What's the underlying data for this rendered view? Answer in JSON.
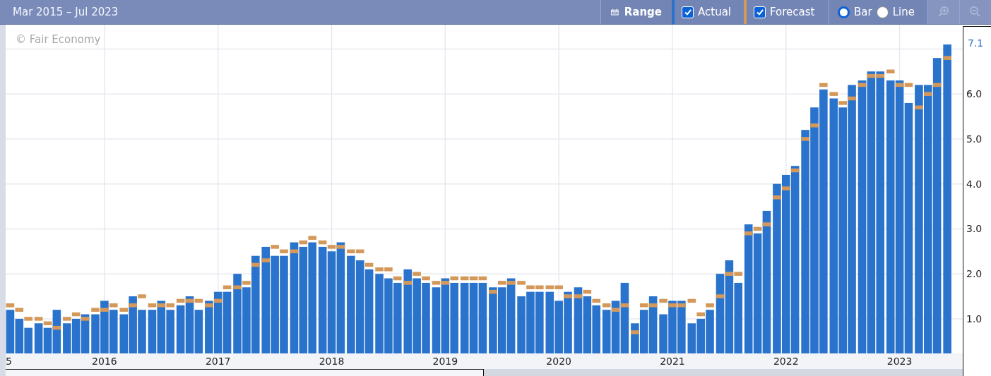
{
  "toolbar": {
    "title": "Mar 2015 – Jul 2023",
    "range_button": "Range",
    "series_toggles": [
      {
        "checked": true
      },
      {
        "checked": true
      }
    ],
    "chart_types": [
      {
        "label": "Bar",
        "selected": true
      },
      {
        "label": "Line",
        "selected": false
      }
    ],
    "zoom_buttons": [
      {
        "kind": "zoom-in",
        "disabled": true
      },
      {
        "kind": "zoom-out",
        "disabled": true
      }
    ]
  },
  "chart": {
    "credit": "© Fair Economy",
    "cut_axis_label": "5",
    "chart_data": {
      "type": "bar",
      "grid": true,
      "ylim": [
        0.23,
        7.54
      ],
      "xlim": [
        2015.13,
        2023.556
      ],
      "yticks": [
        {
          "value": 1,
          "label": "1.0"
        },
        {
          "value": 2,
          "label": "2.0"
        },
        {
          "value": 3,
          "label": "3.0"
        },
        {
          "value": 4,
          "label": "4.0"
        },
        {
          "value": 5,
          "label": "5.0"
        },
        {
          "value": 6,
          "label": "6.0"
        }
      ],
      "xticks": [
        {
          "value": 2016,
          "label": "2016"
        },
        {
          "value": 2017,
          "label": "2017"
        },
        {
          "value": 2018,
          "label": "2018"
        },
        {
          "value": 2019,
          "label": "2019"
        },
        {
          "value": 2020,
          "label": "2020"
        },
        {
          "value": 2021,
          "label": "2021"
        },
        {
          "value": 2022,
          "label": "2022"
        },
        {
          "value": 2023,
          "label": "2023"
        }
      ],
      "x": [
        2015.17,
        2015.25,
        2015.33,
        2015.42,
        2015.5,
        2015.58,
        2015.67,
        2015.75,
        2015.83,
        2015.92,
        2016.0,
        2016.08,
        2016.17,
        2016.25,
        2016.33,
        2016.42,
        2016.5,
        2016.58,
        2016.67,
        2016.75,
        2016.83,
        2016.92,
        2017.0,
        2017.08,
        2017.17,
        2017.25,
        2017.33,
        2017.42,
        2017.5,
        2017.58,
        2017.67,
        2017.75,
        2017.83,
        2017.92,
        2018.0,
        2018.08,
        2018.17,
        2018.25,
        2018.33,
        2018.42,
        2018.5,
        2018.58,
        2018.67,
        2018.75,
        2018.83,
        2018.92,
        2019.0,
        2019.08,
        2019.17,
        2019.25,
        2019.33,
        2019.42,
        2019.5,
        2019.58,
        2019.67,
        2019.75,
        2019.83,
        2019.92,
        2020.0,
        2020.08,
        2020.17,
        2020.25,
        2020.33,
        2020.42,
        2020.5,
        2020.58,
        2020.67,
        2020.75,
        2020.83,
        2020.92,
        2021.0,
        2021.08,
        2021.17,
        2021.25,
        2021.33,
        2021.42,
        2021.5,
        2021.58,
        2021.67,
        2021.75,
        2021.83,
        2021.92,
        2022.0,
        2022.08,
        2022.17,
        2022.25,
        2022.33,
        2022.42,
        2022.5,
        2022.58,
        2022.67,
        2022.75,
        2022.83,
        2022.92,
        2023.0,
        2023.08,
        2023.17,
        2023.25,
        2023.33,
        2023.42
      ],
      "series": [
        {
          "name": "Actual",
          "type": "bar",
          "color": "#2a73cc",
          "values": [
            1.2,
            1.0,
            0.8,
            0.9,
            0.8,
            1.2,
            0.9,
            1.0,
            1.1,
            1.1,
            1.4,
            1.2,
            1.1,
            1.5,
            1.2,
            1.2,
            1.4,
            1.2,
            1.3,
            1.5,
            1.2,
            1.4,
            1.6,
            1.6,
            2.0,
            1.7,
            2.4,
            2.6,
            2.4,
            2.4,
            2.7,
            2.6,
            2.7,
            2.6,
            2.5,
            2.7,
            2.4,
            2.3,
            2.1,
            2.0,
            1.9,
            1.8,
            2.1,
            1.9,
            1.8,
            1.7,
            1.9,
            1.8,
            1.8,
            1.8,
            1.8,
            1.7,
            1.7,
            1.9,
            1.5,
            1.6,
            1.6,
            1.6,
            1.4,
            1.6,
            1.7,
            1.5,
            1.3,
            1.2,
            1.4,
            1.8,
            0.9,
            1.2,
            1.5,
            1.1,
            1.4,
            1.4,
            0.9,
            1.0,
            1.2,
            2.0,
            2.3,
            1.8,
            3.1,
            2.9,
            3.4,
            4.0,
            4.2,
            4.4,
            5.2,
            5.7,
            6.1,
            5.9,
            5.7,
            6.2,
            6.3,
            6.5,
            6.5,
            6.3,
            6.3,
            5.8,
            6.2,
            6.2,
            6.8,
            7.1
          ]
        },
        {
          "name": "Forecast",
          "type": "scatter",
          "color": "#d4995a",
          "values": [
            1.3,
            1.2,
            1.0,
            1.0,
            0.9,
            0.8,
            1.0,
            1.1,
            1.0,
            1.2,
            1.2,
            1.3,
            1.2,
            1.3,
            1.5,
            1.3,
            1.3,
            1.3,
            1.4,
            1.4,
            1.4,
            1.3,
            1.4,
            1.7,
            1.7,
            1.8,
            2.2,
            2.3,
            2.6,
            2.5,
            2.5,
            2.7,
            2.8,
            2.7,
            2.6,
            2.6,
            2.5,
            2.5,
            2.2,
            2.1,
            2.1,
            1.9,
            1.8,
            2.0,
            1.9,
            1.8,
            1.8,
            1.9,
            1.9,
            1.9,
            1.9,
            1.6,
            1.8,
            1.8,
            1.8,
            1.7,
            1.7,
            1.7,
            1.7,
            1.5,
            1.5,
            1.6,
            1.4,
            1.3,
            1.2,
            1.3,
            0.7,
            1.3,
            1.3,
            1.4,
            1.3,
            1.3,
            1.4,
            1.1,
            1.3,
            1.5,
            2.0,
            2.0,
            2.9,
            3.0,
            3.1,
            3.7,
            3.9,
            4.3,
            5.0,
            5.3,
            6.2,
            6.0,
            5.8,
            5.9,
            6.2,
            6.4,
            6.4,
            6.5,
            6.2,
            6.2,
            5.7,
            6.0,
            6.2,
            6.8
          ]
        }
      ],
      "annotations": [
        "7.1"
      ]
    }
  }
}
